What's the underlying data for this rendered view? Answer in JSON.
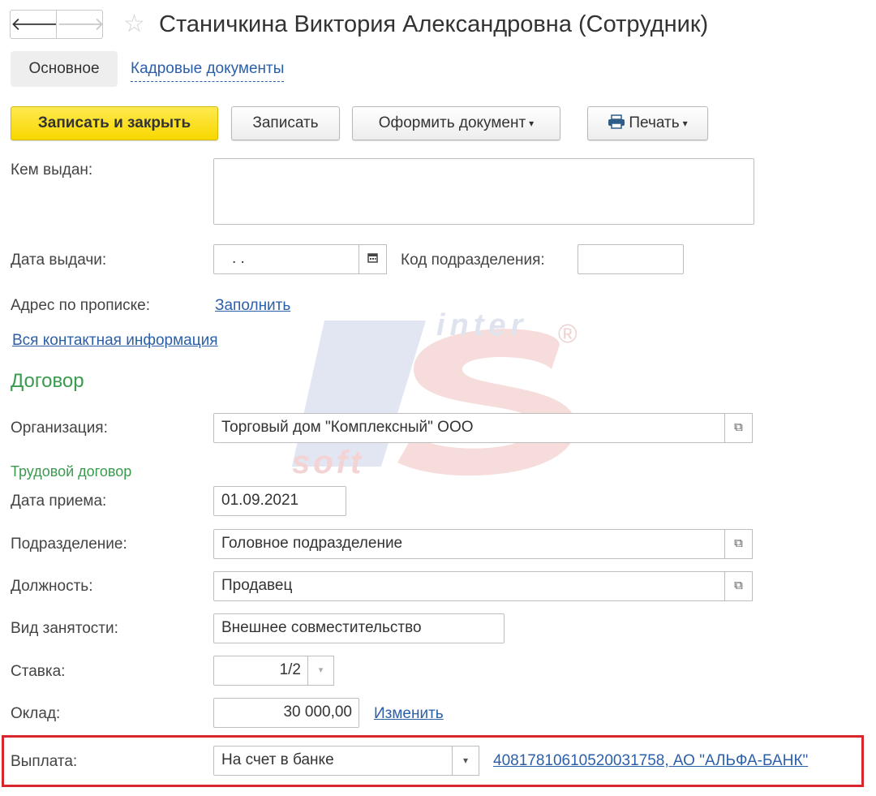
{
  "window": {
    "title": "Станичкина Виктория Александровна (Сотрудник)"
  },
  "nav": {
    "back_glyph": "🡐",
    "forward_glyph": "🡒",
    "favorite_glyph": "☆"
  },
  "tabs": [
    {
      "label": "Основное",
      "active": true
    },
    {
      "label": "Кадровые документы",
      "active": false
    }
  ],
  "toolbar": {
    "save_close_label": "Записать и закрыть",
    "save_label": "Записать",
    "create_doc_label": "Оформить документ",
    "print_label": "Печать",
    "print_icon": "printer-icon"
  },
  "form": {
    "issued_by": {
      "label": "Кем выдан:",
      "value": ""
    },
    "issue_date": {
      "label": "Дата выдачи:",
      "value": ". ."
    },
    "dept_code": {
      "label": "Код подразделения:",
      "value": ""
    },
    "address": {
      "label": "Адрес по прописке:",
      "link": "Заполнить"
    },
    "all_contacts_link": "Вся контактная информация"
  },
  "contract": {
    "heading": "Договор",
    "organization": {
      "label": "Организация:",
      "value": "Торговый дом \"Комплексный\" ООО"
    },
    "labor_heading": "Трудовой договор",
    "hire_date": {
      "label": "Дата приема:",
      "value": "01.09.2021"
    },
    "department": {
      "label": "Подразделение:",
      "value": "Головное подразделение"
    },
    "position": {
      "label": "Должность:",
      "value": "Продавец"
    },
    "employment_type": {
      "label": "Вид занятости:",
      "value": "Внешнее совместительство"
    },
    "rate": {
      "label": "Ставка:",
      "value": "1/2"
    },
    "salary": {
      "label": "Оклад:",
      "value": "30 000,00",
      "change_link": "Изменить"
    },
    "payment": {
      "label": "Выплата:",
      "value": "На счет в банке",
      "account_link": "40817810610520031758, АО \"АЛЬФА-БАНК\""
    }
  },
  "watermark": {
    "top_text": "inter",
    "bottom_text": "soft",
    "registered": "®"
  },
  "colors": {
    "primary_button": "#f8d800",
    "link": "#2b5fa8",
    "section_heading": "#3a9a4e",
    "highlight_border": "#d9262e"
  }
}
